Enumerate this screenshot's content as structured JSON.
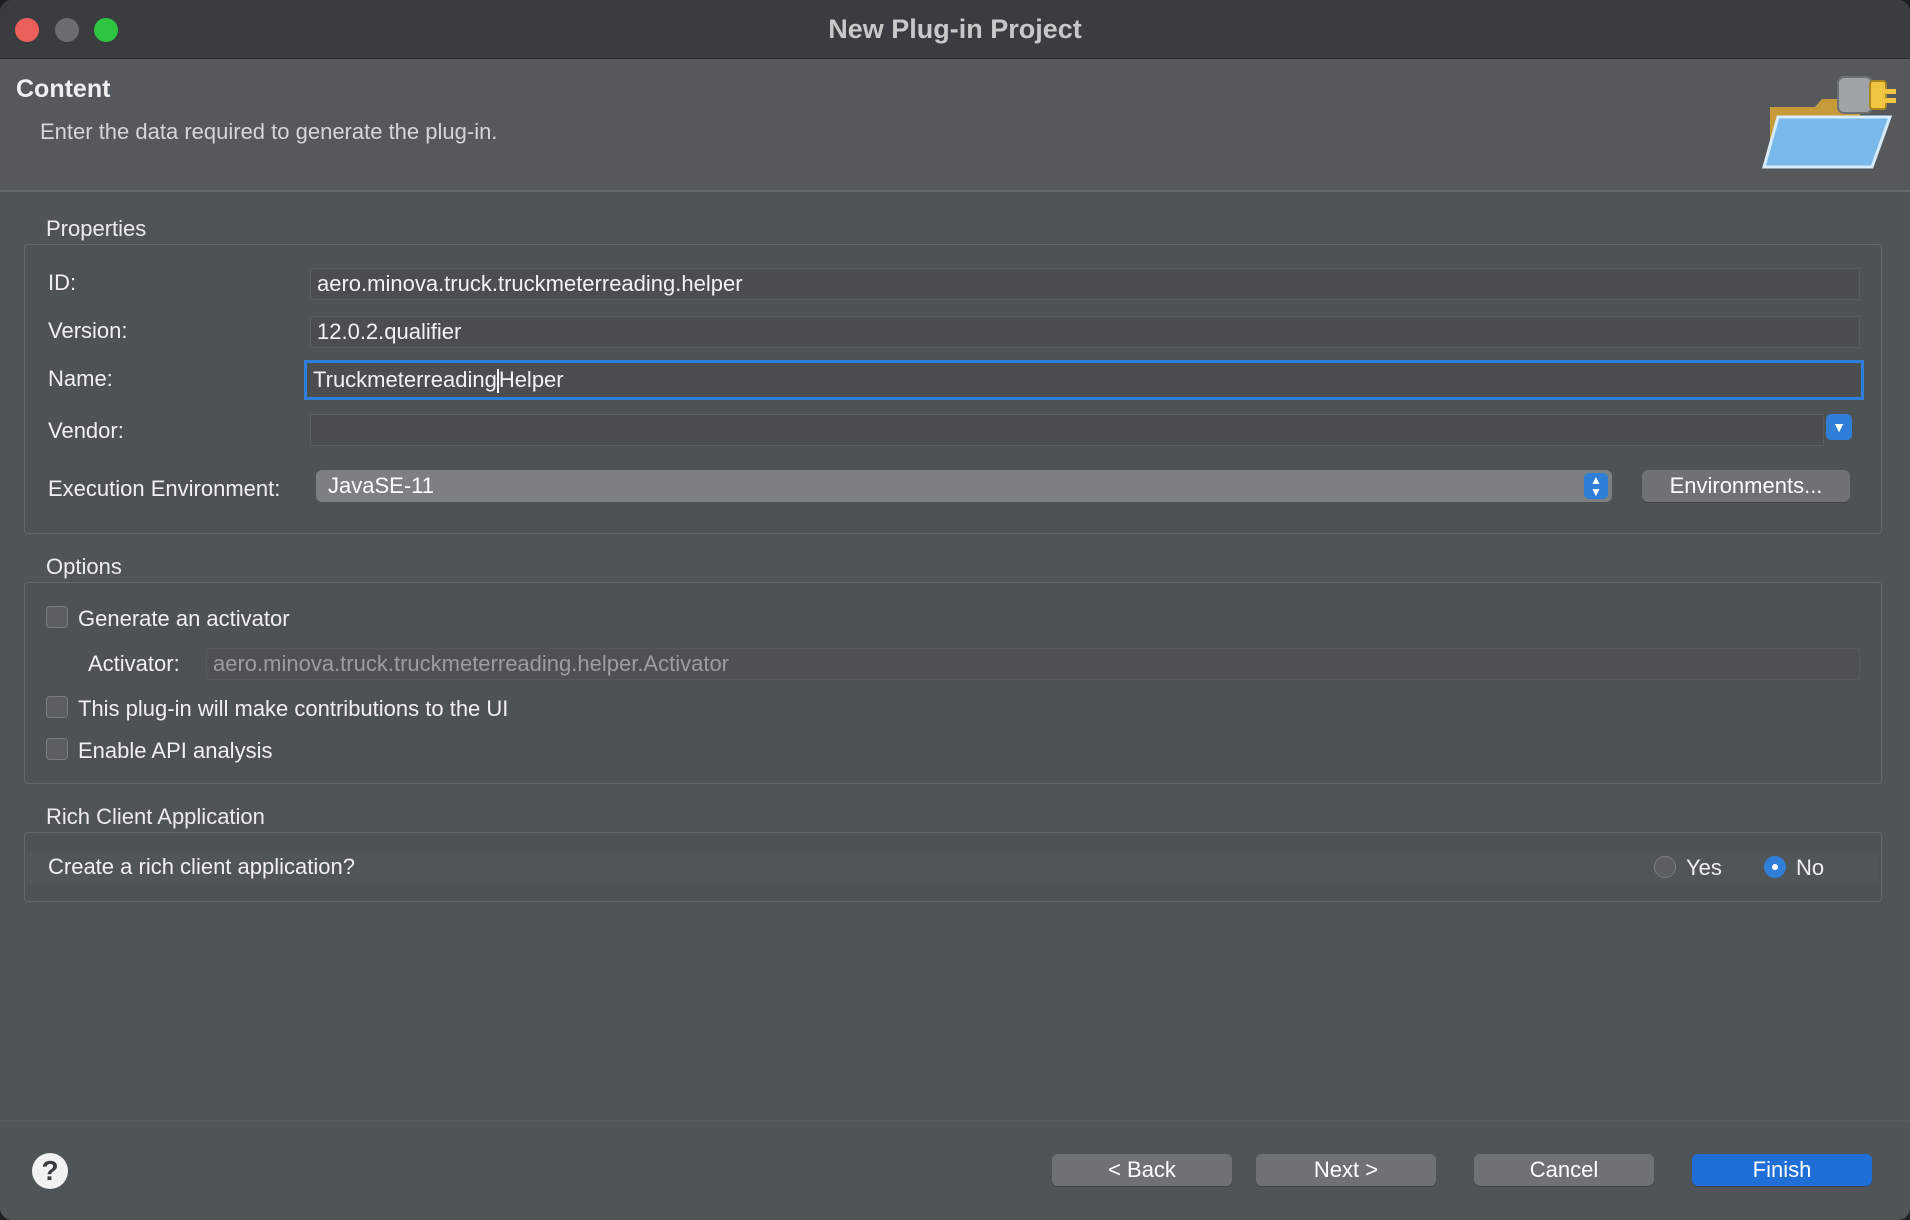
{
  "window": {
    "title": "New Plug-in Project"
  },
  "header": {
    "title": "Content",
    "description": "Enter the data required to generate the plug-in.",
    "icon": "folder-plugin-icon"
  },
  "properties": {
    "section_title": "Properties",
    "id_label": "ID:",
    "id_value": "aero.minova.truck.truckmeterreading.helper",
    "version_label": "Version:",
    "version_value": "12.0.2.qualifier",
    "name_label": "Name:",
    "name_value_before_caret": "Truckmeterreading",
    "name_value_after_caret": "Helper",
    "vendor_label": "Vendor:",
    "vendor_value": "",
    "exec_env_label": "Execution Environment:",
    "exec_env_value": "JavaSE-11",
    "environments_button": "Environments..."
  },
  "options": {
    "section_title": "Options",
    "generate_activator_label": "Generate an activator",
    "generate_activator_checked": false,
    "activator_label": "Activator:",
    "activator_value": "aero.minova.truck.truckmeterreading.helper.Activator",
    "ui_contrib_label": "This plug-in will make contributions to the UI",
    "ui_contrib_checked": false,
    "api_analysis_label": "Enable API analysis",
    "api_analysis_checked": false
  },
  "rca": {
    "section_title": "Rich Client Application",
    "question": "Create a rich client application?",
    "yes_label": "Yes",
    "no_label": "No",
    "selected": "No"
  },
  "footer": {
    "help_glyph": "?",
    "back_label": "< Back",
    "next_label": "Next >",
    "cancel_label": "Cancel",
    "finish_label": "Finish"
  },
  "colors": {
    "accent": "#2f7fd8",
    "finish_button": "#1f6fd6",
    "window_bg": "#4f5457"
  }
}
